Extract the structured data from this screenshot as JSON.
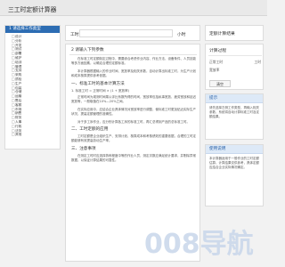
{
  "header": {
    "app_title": "三工时定额计算器"
  },
  "tree": {
    "title": "1 请选择工作类型",
    "items": [
      {
        "pm": "□",
        "label": "设计",
        "level": 2
      },
      {
        "pm": "□",
        "label": "分析",
        "level": 2
      },
      {
        "pm": "□",
        "label": "开发",
        "level": 2
      },
      {
        "pm": "□",
        "label": "测试",
        "level": 2
      },
      {
        "pm": "□",
        "label": "部署",
        "level": 2
      },
      {
        "pm": "□",
        "label": "维护",
        "level": 2
      },
      {
        "pm": "□",
        "label": "培训",
        "level": 2
      },
      {
        "pm": "□",
        "label": "管理",
        "level": 2
      },
      {
        "pm": "□",
        "label": "支持",
        "level": 2
      },
      {
        "pm": "□",
        "label": "采购",
        "level": 2
      },
      {
        "pm": "□",
        "label": "质检",
        "level": 2
      },
      {
        "pm": "□",
        "label": "生产",
        "level": 2
      },
      {
        "pm": "□",
        "label": "包装",
        "level": 2
      },
      {
        "pm": "□",
        "label": "仓储",
        "level": 2
      },
      {
        "pm": "□",
        "label": "运输",
        "level": 2
      },
      {
        "pm": "□",
        "label": "售后",
        "level": 2
      },
      {
        "pm": "□",
        "label": "客服",
        "level": 2
      },
      {
        "pm": "□",
        "label": "市场",
        "level": 2
      },
      {
        "pm": "□",
        "label": "销售",
        "level": 2
      },
      {
        "pm": "□",
        "label": "财务",
        "level": 2
      },
      {
        "pm": "□",
        "label": "人事",
        "level": 2
      },
      {
        "pm": "□",
        "label": "行政",
        "level": 2
      },
      {
        "pm": "□",
        "label": "法务",
        "level": 2
      },
      {
        "pm": "□",
        "label": "其他",
        "level": 2
      }
    ]
  },
  "calc": {
    "label": "工时",
    "unit": "小时",
    "value": ""
  },
  "main": {
    "tab_label": "2 请输入下列参数",
    "sections": [
      {
        "type": "para",
        "text": "在标准工时定额制定过程中，需要综合考虑作业内容、作业方法、设备条件、人员技能等多方面因素，以确定合理的定额标准。"
      },
      {
        "type": "para",
        "text": "本计算器根据输入的作业时间、宽放率及相关系数，自动计算出标准工时，为生产计划和成本核算提供参考依据。"
      },
      {
        "type": "title",
        "text": "一、标准工时的基本计算方法"
      },
      {
        "type": "sub",
        "text": "1. 标准工时 = 正常时间 × (1 + 宽放率)"
      },
      {
        "type": "para",
        "text": "正常时间为观测时间乘以评比系数所得的时间，宽放率包括私事宽放、疲劳宽放和延迟宽放等，一般取值在10%—20%之间。"
      },
      {
        "type": "para",
        "text": "在实际应用中，应结合企业具体情况对宽放率进行调整，使标准工时更加贴近实际生产状况，提高定额管理的准确性。"
      },
      {
        "type": "para",
        "text": "对于多工序作业，应分别计算各工序的标准工时，再汇总得到产品的总标准工时。"
      },
      {
        "type": "title",
        "text": "二、工时定额的应用"
      },
      {
        "type": "para",
        "text": "工时定额是企业组织生产、安排计划、核算成本和考核绩效的重要依据，合理的工时定额能够有效提高劳动生产率。"
      },
      {
        "type": "title",
        "text": "三、注意事项"
      },
      {
        "type": "para",
        "text": "在测定工时时应选择熟练程度中等的作业人员，测定次数应满足统计要求，并剔除异常数据，以保证计算结果的可靠性。"
      }
    ]
  },
  "right": {
    "result_title": "定额计算结果",
    "calc_box_title": "计算过程",
    "res_rows": [
      {
        "k": "正常工时",
        "v": "工时",
        "k2": "宽放率",
        "v2": ""
      }
    ],
    "res_btn": "清空",
    "note_title": "提示",
    "note_text": "请先选择左侧工作类型，再输入相关参数，系统将自动计算标准工时及定额结果。",
    "use_title": "使用说明",
    "use_text": "本计算器适用于一般作业的工时定额估算，计算结果仅供参考，具体定额应结合企业实际情况确定。"
  },
  "colors": {
    "header_blue": "#2d6db3",
    "link_blue": "#2a62a8",
    "panel_bg": "#ffffff",
    "page_bg": "#f2f2f2"
  }
}
